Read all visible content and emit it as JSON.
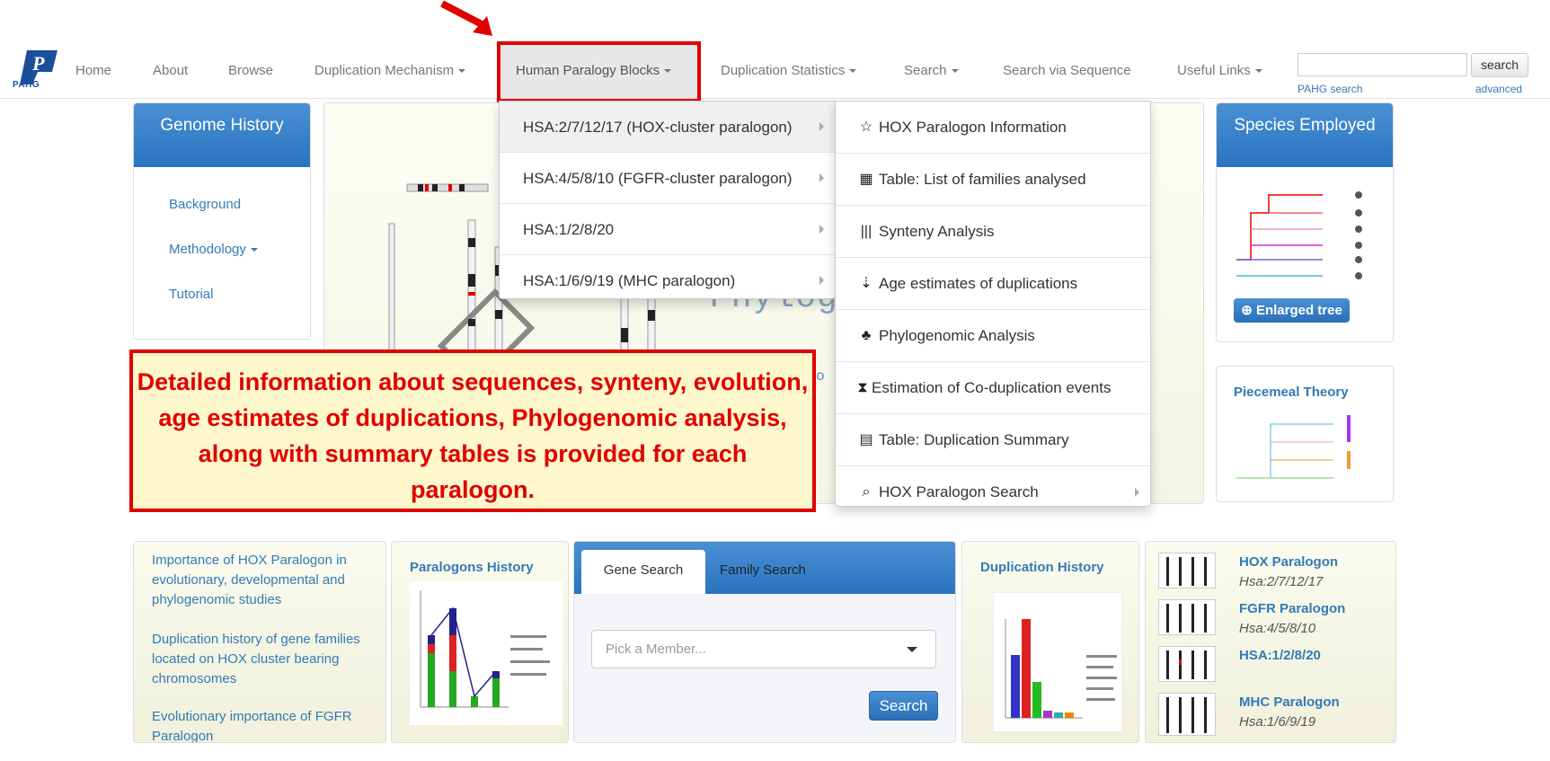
{
  "nav": {
    "logo_text": "PAHG",
    "items": [
      "Home",
      "About",
      "Browse",
      "Duplication Mechanism",
      "Human Paralogy Blocks",
      "Duplication Statistics",
      "Search",
      "Search via Sequence",
      "Useful Links"
    ],
    "search_button": "search",
    "pahg_search_link": "PAHG search",
    "advanced_link": "advanced"
  },
  "genome_history": {
    "title": "Genome History",
    "links": [
      "Background",
      "Methodology",
      "Tutorial"
    ]
  },
  "species": {
    "title": "Species Employed",
    "enlarged_button": "Enlarged tree"
  },
  "piecemeal": {
    "title": "Piecemeal Theory"
  },
  "banner": {
    "word": "Phylog",
    "fragment": "to"
  },
  "dropdown_blocks": [
    "HSA:2/7/12/17 (HOX-cluster paralogon)",
    "HSA:4/5/8/10 (FGFR-cluster paralogon)",
    "HSA:1/2/8/20",
    "HSA:1/6/9/19 (MHC paralogon)"
  ],
  "dropdown_sub": [
    {
      "icon": "☆",
      "label": "HOX Paralogon Information"
    },
    {
      "icon": "▦",
      "label": "Table: List of families analysed"
    },
    {
      "icon": "|||",
      "label": "Synteny Analysis"
    },
    {
      "icon": "⇣",
      "label": "Age estimates of duplications"
    },
    {
      "icon": "♣",
      "label": "Phylogenomic Analysis"
    },
    {
      "icon": "⧗",
      "label": "Estimation of Co-duplication events"
    },
    {
      "icon": "▤",
      "label": "Table: Duplication Summary"
    },
    {
      "icon": "⌕",
      "label": "HOX Paralogon Search"
    }
  ],
  "callout": "Detailed information about sequences, synteny, evolution, age estimates of duplications, Phylogenomic analysis, along with summary tables is provided for each paralogon.",
  "news_links": [
    "Importance of HOX Paralogon in evolutionary, developmental and phylogenomic studies",
    "Duplication history of gene families located on HOX cluster bearing chromosomes",
    "Evolutionary importance of FGFR Paralogon"
  ],
  "paralogons_history": {
    "title": "Paralogons History"
  },
  "gene_search": {
    "tab_gene": "Gene Search",
    "tab_family": "Family Search",
    "placeholder": "Pick a Member...",
    "search_button": "Search"
  },
  "duplication_history": {
    "title": "Duplication History"
  },
  "paralogons": [
    {
      "title": "HOX Paralogon",
      "sub": "Hsa:2/7/12/17"
    },
    {
      "title": "FGFR Paralogon",
      "sub": "Hsa:4/5/8/10"
    },
    {
      "title": "HSA:1/2/8/20",
      "sub": ""
    },
    {
      "title": "MHC Paralogon",
      "sub": "Hsa:1/6/9/19"
    }
  ],
  "colors": {
    "accent_red": "#e00000",
    "link_blue": "#337ab7",
    "panel_blue": "#2a73c0"
  }
}
